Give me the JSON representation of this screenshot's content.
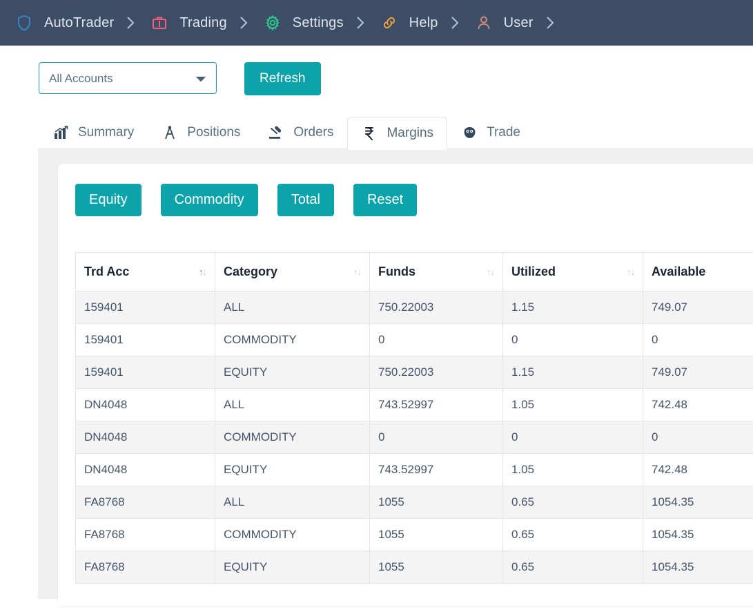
{
  "navbar": {
    "items": [
      {
        "label": "AutoTrader",
        "icon": "shield-icon",
        "color": "#3b82c4"
      },
      {
        "label": "Trading",
        "icon": "briefcase-icon",
        "color": "#f0607a"
      },
      {
        "label": "Settings",
        "icon": "gear-icon",
        "color": "#2ec98b"
      },
      {
        "label": "Help",
        "icon": "link-icon",
        "color": "#f5a33c"
      },
      {
        "label": "User",
        "icon": "person-icon",
        "color": "#c98b7a"
      }
    ],
    "background": "#3d4d66"
  },
  "controls": {
    "account_select": {
      "value": "All Accounts",
      "options": [
        "All Accounts"
      ]
    },
    "refresh_label": "Refresh"
  },
  "tabs": [
    {
      "label": "Summary",
      "icon": "chart-up-icon",
      "active": false
    },
    {
      "label": "Positions",
      "icon": "compass-icon",
      "active": false
    },
    {
      "label": "Orders",
      "icon": "gavel-icon",
      "active": false
    },
    {
      "label": "Margins",
      "icon": "rupee-icon",
      "active": true
    },
    {
      "label": "Trade",
      "icon": "brain-icon",
      "active": false
    }
  ],
  "filter_buttons": [
    {
      "label": "Equity"
    },
    {
      "label": "Commodity"
    },
    {
      "label": "Total"
    },
    {
      "label": "Reset"
    }
  ],
  "table": {
    "columns": [
      {
        "label": "Trd Acc",
        "sortable": true,
        "sort_active": true
      },
      {
        "label": "Category",
        "sortable": true,
        "sort_active": false
      },
      {
        "label": "Funds",
        "sortable": true,
        "sort_active": false
      },
      {
        "label": "Utilized",
        "sortable": true,
        "sort_active": false
      },
      {
        "label": "Available",
        "sortable": false,
        "sort_active": false
      }
    ],
    "rows": [
      {
        "trd_acc": "159401",
        "category": "ALL",
        "funds": "750.22003",
        "utilized": "1.15",
        "available": "749.07"
      },
      {
        "trd_acc": "159401",
        "category": "COMMODITY",
        "funds": "0",
        "utilized": "0",
        "available": "0"
      },
      {
        "trd_acc": "159401",
        "category": "EQUITY",
        "funds": "750.22003",
        "utilized": "1.15",
        "available": "749.07"
      },
      {
        "trd_acc": "DN4048",
        "category": "ALL",
        "funds": "743.52997",
        "utilized": "1.05",
        "available": "742.48"
      },
      {
        "trd_acc": "DN4048",
        "category": "COMMODITY",
        "funds": "0",
        "utilized": "0",
        "available": "0"
      },
      {
        "trd_acc": "DN4048",
        "category": "EQUITY",
        "funds": "743.52997",
        "utilized": "1.05",
        "available": "742.48"
      },
      {
        "trd_acc": "FA8768",
        "category": "ALL",
        "funds": "1055",
        "utilized": "0.65",
        "available": "1054.35"
      },
      {
        "trd_acc": "FA8768",
        "category": "COMMODITY",
        "funds": "1055",
        "utilized": "0.65",
        "available": "1054.35"
      },
      {
        "trd_acc": "FA8768",
        "category": "EQUITY",
        "funds": "1055",
        "utilized": "0.65",
        "available": "1054.35"
      }
    ]
  },
  "colors": {
    "accent_teal": "#0ca3aa",
    "navbar_bg": "#3d4d66",
    "panel_bg": "#f0f0f1"
  }
}
